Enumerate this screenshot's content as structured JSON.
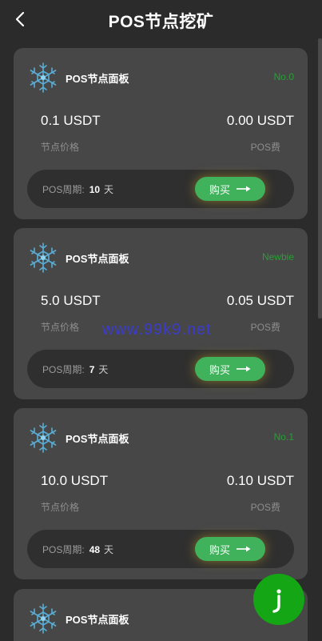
{
  "header": {
    "title": "POS节点挖矿"
  },
  "watermark": "www.99k9.net",
  "labels": {
    "price_label": "节点价格",
    "fee_label": "POS费",
    "period_label": "POS周期:",
    "period_unit": "天",
    "buy_label": "购买"
  },
  "cards": [
    {
      "name": "POS节点面板",
      "tag": "No.0",
      "price": "0.1 USDT",
      "fee": "0.00 USDT",
      "period": "10"
    },
    {
      "name": "POS节点面板",
      "tag": "Newbie",
      "price": "5.0 USDT",
      "fee": "0.05 USDT",
      "period": "7"
    },
    {
      "name": "POS节点面板",
      "tag": "No.1",
      "price": "10.0 USDT",
      "fee": "0.10 USDT",
      "period": "48"
    },
    {
      "name": "POS节点面板"
    }
  ],
  "colors": {
    "background": "#2b2b2b",
    "card": "#474747",
    "accent": "#3fb25b",
    "tag": "#2a9d38",
    "fab": "#14a614"
  },
  "icons": {
    "back": "chevron-left-icon",
    "logo": "snowflake-icon",
    "arrow": "arrow-right-icon",
    "fab": "chat-icon"
  }
}
